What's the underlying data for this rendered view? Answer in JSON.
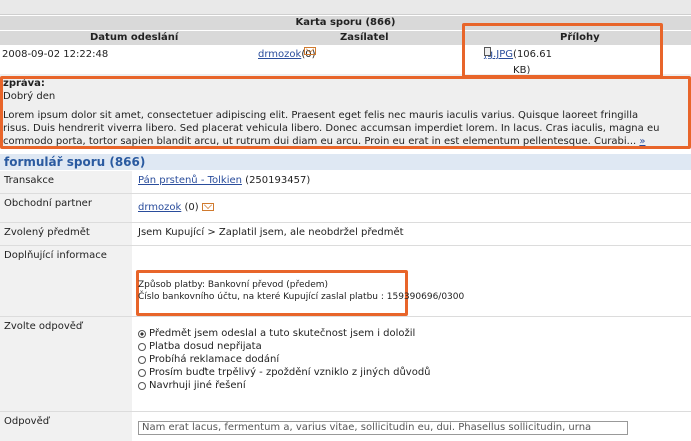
{
  "card": {
    "title": "Karta sporu (866)",
    "col_date": "Datum odeslání",
    "col_sender": "Zasílatel",
    "col_attachments": "Přílohy",
    "date": "2008-09-02 12:22:48",
    "sender_name": "drmozok",
    "sender_score": "(0)",
    "attachment_name": "jg.JPG",
    "attachment_size": "(106.61 KB)"
  },
  "message": {
    "label": "zpráva:",
    "greeting": "Dobrý den",
    "line1": "Lorem ipsum dolor sit amet, consectetuer adipiscing elit. Praesent eget felis nec mauris iaculis varius. Quisque laoreet fringilla",
    "line2": "risus. Duis hendrerit viverra libero. Sed placerat vehicula libero. Donec accumsan imperdiet lorem. In lacus. Cras iaculis, magna eu",
    "line3": "commodo porta, tortor sapien blandit arcu, ut rutrum dui diam eu arcu. Proin eu erat in est elementum pellentesque. Curabi...",
    "more": "»"
  },
  "form": {
    "title": "formulář sporu (866)",
    "rows": {
      "transakce_label": "Transakce",
      "transakce_link": "Pán prstenů - Tolkien",
      "transakce_id": "(250193457)",
      "partner_label": "Obchodní partner",
      "partner_name": "drmozok",
      "partner_score": "(0)",
      "subject_label": "Zvolený předmět",
      "subject_value": "Jsem Kupující > Zaplatil jsem, ale neobdržel předmět",
      "info_label": "Doplňující informace",
      "info_line1": "Způsob platby: Bankovní převod (předem)",
      "info_line2": "Číslo bankovního účtu, na které Kupující zaslal platbu : 159390696/0300",
      "answer_label": "Zvolte odpověď",
      "options": [
        "Předmět jsem odeslal a tuto skutečnost jsem i doložil",
        "Platba dosud nepřijata",
        "Probíhá reklamace dodání",
        "Prosím buďte trpělivý - zpoždění vzniklo z jiných důvodů",
        "Navrhuji jiné řešení"
      ],
      "reply_label": "Odpověď",
      "reply_value": "Nam erat lacus, fermentum a, varius vitae, sollicitudin eu, dui. Phasellus sollicitudin, urna"
    }
  },
  "colors": {
    "highlight": "#e8652a",
    "link": "#2a4d9c",
    "form_header": "#2a5aa0"
  }
}
